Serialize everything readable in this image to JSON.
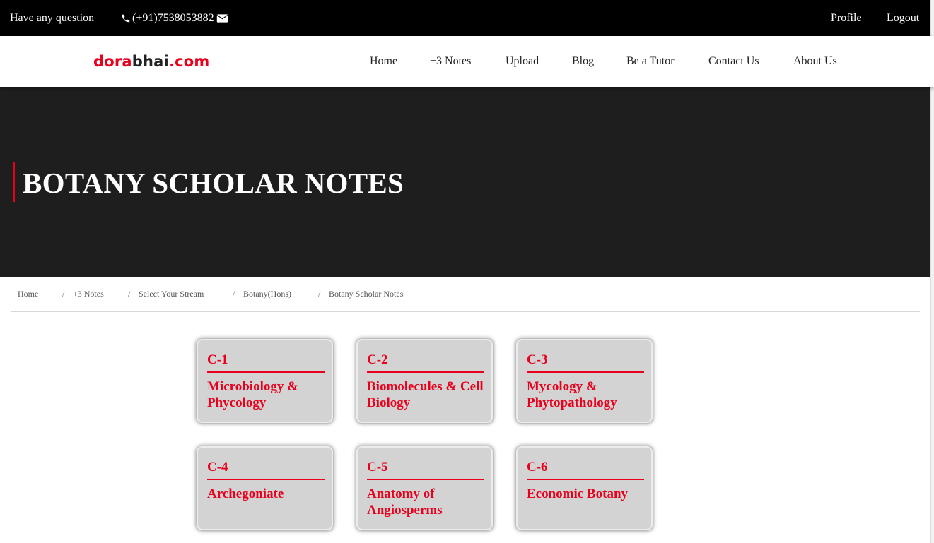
{
  "topbar": {
    "question": "Have any question",
    "phone": "(+91)7538053882",
    "profile": "Profile",
    "logout": "Logout"
  },
  "logo": {
    "part1": "dora",
    "part2": "bhai",
    "part3": ".com"
  },
  "nav": {
    "items": [
      "Home",
      "+3 Notes",
      "Upload",
      "Blog",
      "Be a Tutor",
      "Contact Us",
      "About Us"
    ]
  },
  "hero": {
    "title": "BOTANY SCHOLAR NOTES"
  },
  "breadcrumb": {
    "items": [
      "Home",
      "+3 Notes",
      "Select Your Stream",
      "Botany(Hons)",
      "Botany Scholar Notes"
    ],
    "separator": "/"
  },
  "cards": [
    {
      "code": "C-1",
      "name": "Microbiology & Phycology"
    },
    {
      "code": "C-2",
      "name": "Biomolecules & Cell Biology"
    },
    {
      "code": "C-3",
      "name": "Mycology & Phytopathology"
    },
    {
      "code": "C-4",
      "name": "Archegoniate"
    },
    {
      "code": "C-5",
      "name": "Anatomy of Angiosperms"
    },
    {
      "code": "C-6",
      "name": "Economic Botany"
    }
  ],
  "colors": {
    "accent": "#e8001c",
    "topbar": "#000000",
    "hero": "#1e1e1f",
    "card": "#d3d3d3"
  },
  "icons": {
    "phone": "phone-icon",
    "email": "envelope-icon"
  }
}
